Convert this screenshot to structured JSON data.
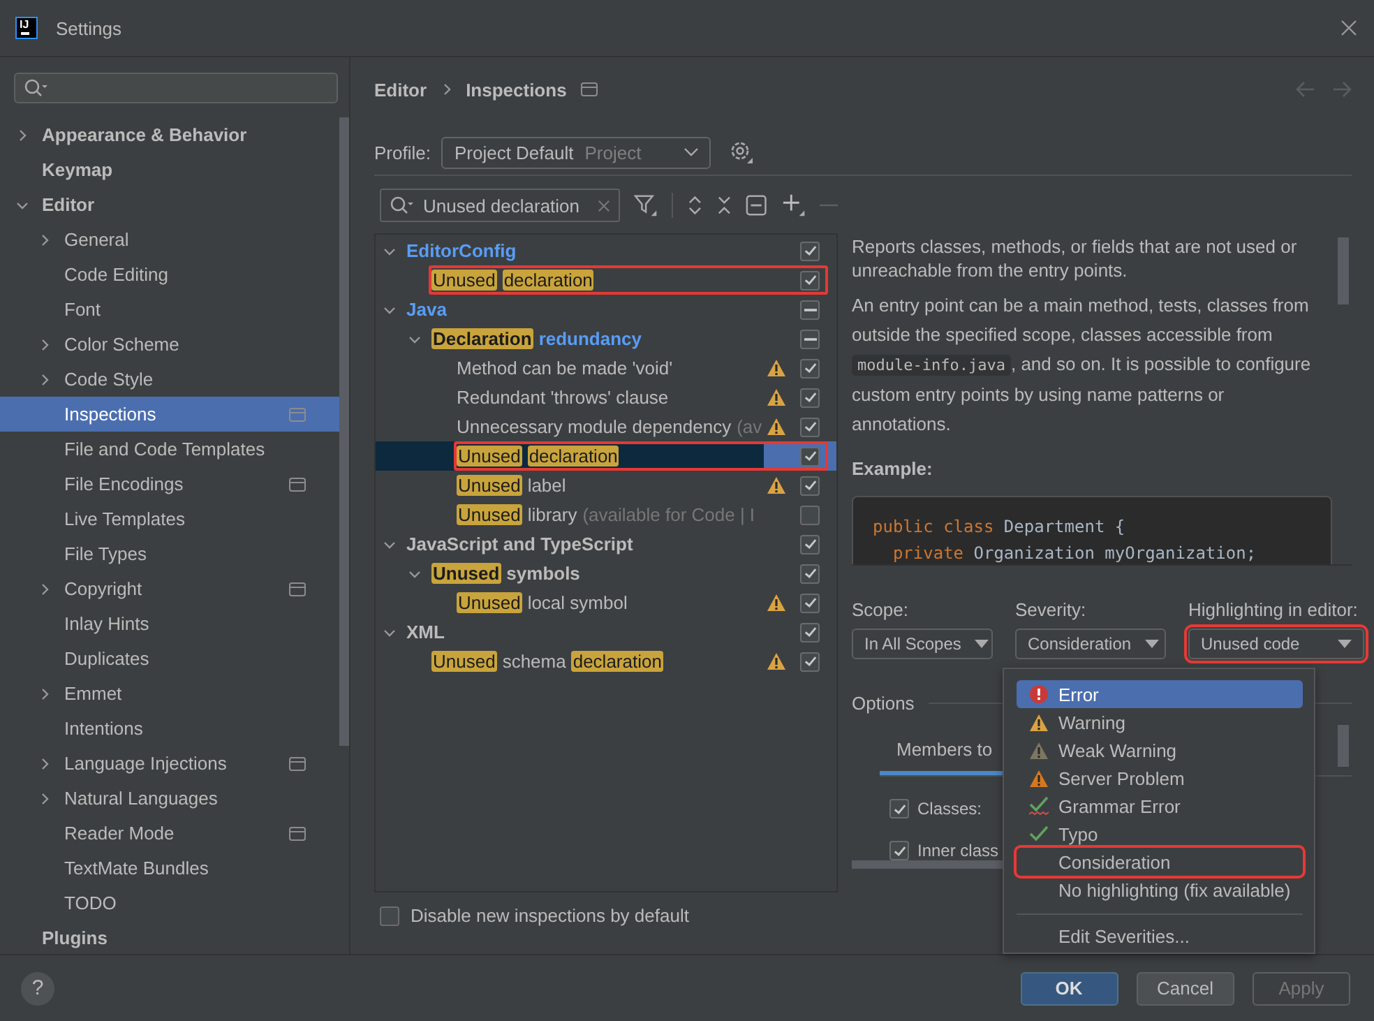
{
  "window": {
    "title": "Settings",
    "logo": "IJ"
  },
  "sidebar": {
    "items": [
      {
        "label": "Appearance & Behavior",
        "expanded": false,
        "selected": false
      },
      {
        "label": "Keymap",
        "selected": false
      },
      {
        "label": "Editor",
        "expanded": true,
        "selected": false,
        "children": [
          {
            "label": "General",
            "expanded": false,
            "selected": false,
            "project": false
          },
          {
            "label": "Code Editing",
            "selected": false,
            "project": false
          },
          {
            "label": "Font",
            "selected": false,
            "project": false
          },
          {
            "label": "Color Scheme",
            "expanded": false,
            "selected": false,
            "project": false
          },
          {
            "label": "Code Style",
            "expanded": false,
            "selected": false,
            "project": false
          },
          {
            "label": "Inspections",
            "selected": true,
            "project": true
          },
          {
            "label": "File and Code Templates",
            "selected": false,
            "project": false
          },
          {
            "label": "File Encodings",
            "selected": false,
            "project": true
          },
          {
            "label": "Live Templates",
            "selected": false,
            "project": false
          },
          {
            "label": "File Types",
            "selected": false,
            "project": false
          },
          {
            "label": "Copyright",
            "expanded": false,
            "selected": false,
            "project": true
          },
          {
            "label": "Inlay Hints",
            "selected": false,
            "project": false
          },
          {
            "label": "Duplicates",
            "selected": false,
            "project": false
          },
          {
            "label": "Emmet",
            "expanded": false,
            "selected": false,
            "project": false
          },
          {
            "label": "Intentions",
            "selected": false,
            "project": false
          },
          {
            "label": "Language Injections",
            "expanded": false,
            "selected": false,
            "project": true
          },
          {
            "label": "Natural Languages",
            "expanded": false,
            "selected": false,
            "project": false
          },
          {
            "label": "Reader Mode",
            "selected": false,
            "project": true
          },
          {
            "label": "TextMate Bundles",
            "selected": false,
            "project": false
          },
          {
            "label": "TODO",
            "selected": false,
            "project": false
          }
        ]
      },
      {
        "label": "Plugins",
        "selected": false
      }
    ]
  },
  "breadcrumb": [
    "Editor",
    "Inspections"
  ],
  "profile": {
    "label": "Profile:",
    "value": "Project Default",
    "scope": "Project"
  },
  "search": {
    "value": "Unused declaration"
  },
  "tree": {
    "nodes": [
      {
        "segments": [
          {
            "text": "EditorConfig",
            "kind": "plain"
          }
        ],
        "modified": true,
        "expanded": true,
        "checked": true,
        "selected": false,
        "framed": false,
        "children": [
          {
            "segments": [
              {
                "text": "Unused",
                "kind": "match"
              },
              {
                "text": "declaration",
                "kind": "match"
              }
            ],
            "checked": true,
            "warning": false,
            "selected": false,
            "framed": true
          }
        ]
      },
      {
        "segments": [
          {
            "text": "Java",
            "kind": "plain"
          }
        ],
        "modified": true,
        "expanded": true,
        "mixed": true,
        "selected": false,
        "framed": false,
        "children": [
          {
            "segments": [
              {
                "text": "Declaration",
                "kind": "match"
              },
              {
                "text": "redundancy",
                "kind": "plain"
              }
            ],
            "modified": true,
            "expanded": true,
            "mixed": true,
            "selected": false,
            "framed": false,
            "children": [
              {
                "segments": [
                  {
                    "text": "Method can be made 'void'",
                    "kind": "plain"
                  }
                ],
                "checked": true,
                "warning": true,
                "selected": false,
                "framed": false
              },
              {
                "segments": [
                  {
                    "text": "Redundant 'throws' clause",
                    "kind": "plain"
                  }
                ],
                "checked": true,
                "warning": true,
                "selected": false,
                "framed": false
              },
              {
                "segments": [
                  {
                    "text": "Unnecessary module dependency",
                    "kind": "plain"
                  },
                  {
                    "text": "(av",
                    "kind": "hint"
                  }
                ],
                "checked": true,
                "warning": true,
                "selected": false,
                "framed": false
              },
              {
                "segments": [
                  {
                    "text": "Unused",
                    "kind": "match"
                  },
                  {
                    "text": "declaration",
                    "kind": "match"
                  }
                ],
                "checked": true,
                "warning": false,
                "selected": true,
                "framed": true
              },
              {
                "segments": [
                  {
                    "text": "Unused",
                    "kind": "match"
                  },
                  {
                    "text": "label",
                    "kind": "plain"
                  }
                ],
                "checked": true,
                "warning": true,
                "selected": false,
                "framed": false
              },
              {
                "segments": [
                  {
                    "text": "Unused",
                    "kind": "match"
                  },
                  {
                    "text": "library",
                    "kind": "plain"
                  },
                  {
                    "text": "(available for Code | I",
                    "kind": "hint"
                  }
                ],
                "checked": false,
                "warning": false,
                "selected": false,
                "framed": false
              }
            ]
          }
        ]
      },
      {
        "segments": [
          {
            "text": "JavaScript and TypeScript",
            "kind": "plain"
          }
        ],
        "modified": false,
        "expanded": true,
        "checked": true,
        "selected": false,
        "framed": false,
        "children": [
          {
            "segments": [
              {
                "text": "Unused",
                "kind": "match"
              },
              {
                "text": "symbols",
                "kind": "plain"
              }
            ],
            "modified": false,
            "expanded": true,
            "checked": true,
            "selected": false,
            "framed": false,
            "children": [
              {
                "segments": [
                  {
                    "text": "Unused",
                    "kind": "match"
                  },
                  {
                    "text": "local symbol",
                    "kind": "plain"
                  }
                ],
                "checked": true,
                "warning": true,
                "selected": false,
                "framed": false
              }
            ]
          }
        ]
      },
      {
        "segments": [
          {
            "text": "XML",
            "kind": "plain"
          }
        ],
        "modified": false,
        "expanded": true,
        "checked": true,
        "selected": false,
        "framed": false,
        "children": [
          {
            "segments": [
              {
                "text": "Unused",
                "kind": "match"
              },
              {
                "text": "schema",
                "kind": "plain"
              },
              {
                "text": "declaration",
                "kind": "match"
              }
            ],
            "checked": true,
            "warning": true,
            "selected": false,
            "framed": false
          }
        ]
      }
    ]
  },
  "disable_new": {
    "label": "Disable new inspections by default",
    "checked": false
  },
  "description": {
    "paragraphs": [
      [
        {
          "text": "Reports classes, methods, or fields that are not used or unreachable from the entry points.",
          "kind": "plain"
        }
      ],
      [
        {
          "text": "An entry point can be a main method, tests, classes from outside the specified scope, classes accessible from ",
          "kind": "plain"
        },
        {
          "text": "module-info.java",
          "kind": "code"
        },
        {
          "text": ", and so on. It is possible to configure custom entry points by using name patterns or annotations.",
          "kind": "plain"
        }
      ]
    ],
    "example_label": "Example:",
    "code": [
      [
        {
          "text": "public class ",
          "kind": "keyword"
        },
        {
          "text": "Department {",
          "kind": "plain"
        }
      ],
      [
        {
          "text": "  private ",
          "kind": "keyword"
        },
        {
          "text": "Organization myOrganization;",
          "kind": "plain"
        }
      ]
    ]
  },
  "settings": {
    "scope": {
      "label": "Scope:",
      "value": "In All Scopes",
      "framed": false
    },
    "severity": {
      "label": "Severity:",
      "value": "Consideration",
      "framed": false
    },
    "highlighting": {
      "label": "Highlighting in editor:",
      "value": "Unused code",
      "framed": true
    },
    "options_title": "Options",
    "tabs": [
      {
        "label": "Members to",
        "selected": true
      }
    ],
    "checkboxes": [
      {
        "label": "Classes:",
        "checked": true
      },
      {
        "label": "Inner class",
        "checked": true
      }
    ]
  },
  "severity_menu": {
    "items": [
      {
        "label": "Error",
        "kind": "error",
        "selected": true,
        "framed": false
      },
      {
        "label": "Warning",
        "kind": "warning",
        "selected": false,
        "framed": false
      },
      {
        "label": "Weak Warning",
        "kind": "weak_warning",
        "selected": false,
        "framed": false
      },
      {
        "label": "Server Problem",
        "kind": "server_problem",
        "selected": false,
        "framed": false
      },
      {
        "label": "Grammar Error",
        "kind": "grammar",
        "selected": false,
        "framed": false
      },
      {
        "label": "Typo",
        "kind": "typo",
        "selected": false,
        "framed": false
      },
      {
        "label": "Consideration",
        "kind": "none",
        "selected": false,
        "framed": true
      },
      {
        "label": "No highlighting (fix available)",
        "kind": "none",
        "selected": false,
        "framed": false
      }
    ],
    "footer_item": "Edit Severities..."
  },
  "footer": {
    "help": "?",
    "buttons": [
      {
        "label": "OK",
        "kind": "primary",
        "disabled": false
      },
      {
        "label": "Cancel",
        "kind": "default",
        "disabled": false
      },
      {
        "label": "Apply",
        "kind": "default",
        "disabled": true
      }
    ]
  }
}
